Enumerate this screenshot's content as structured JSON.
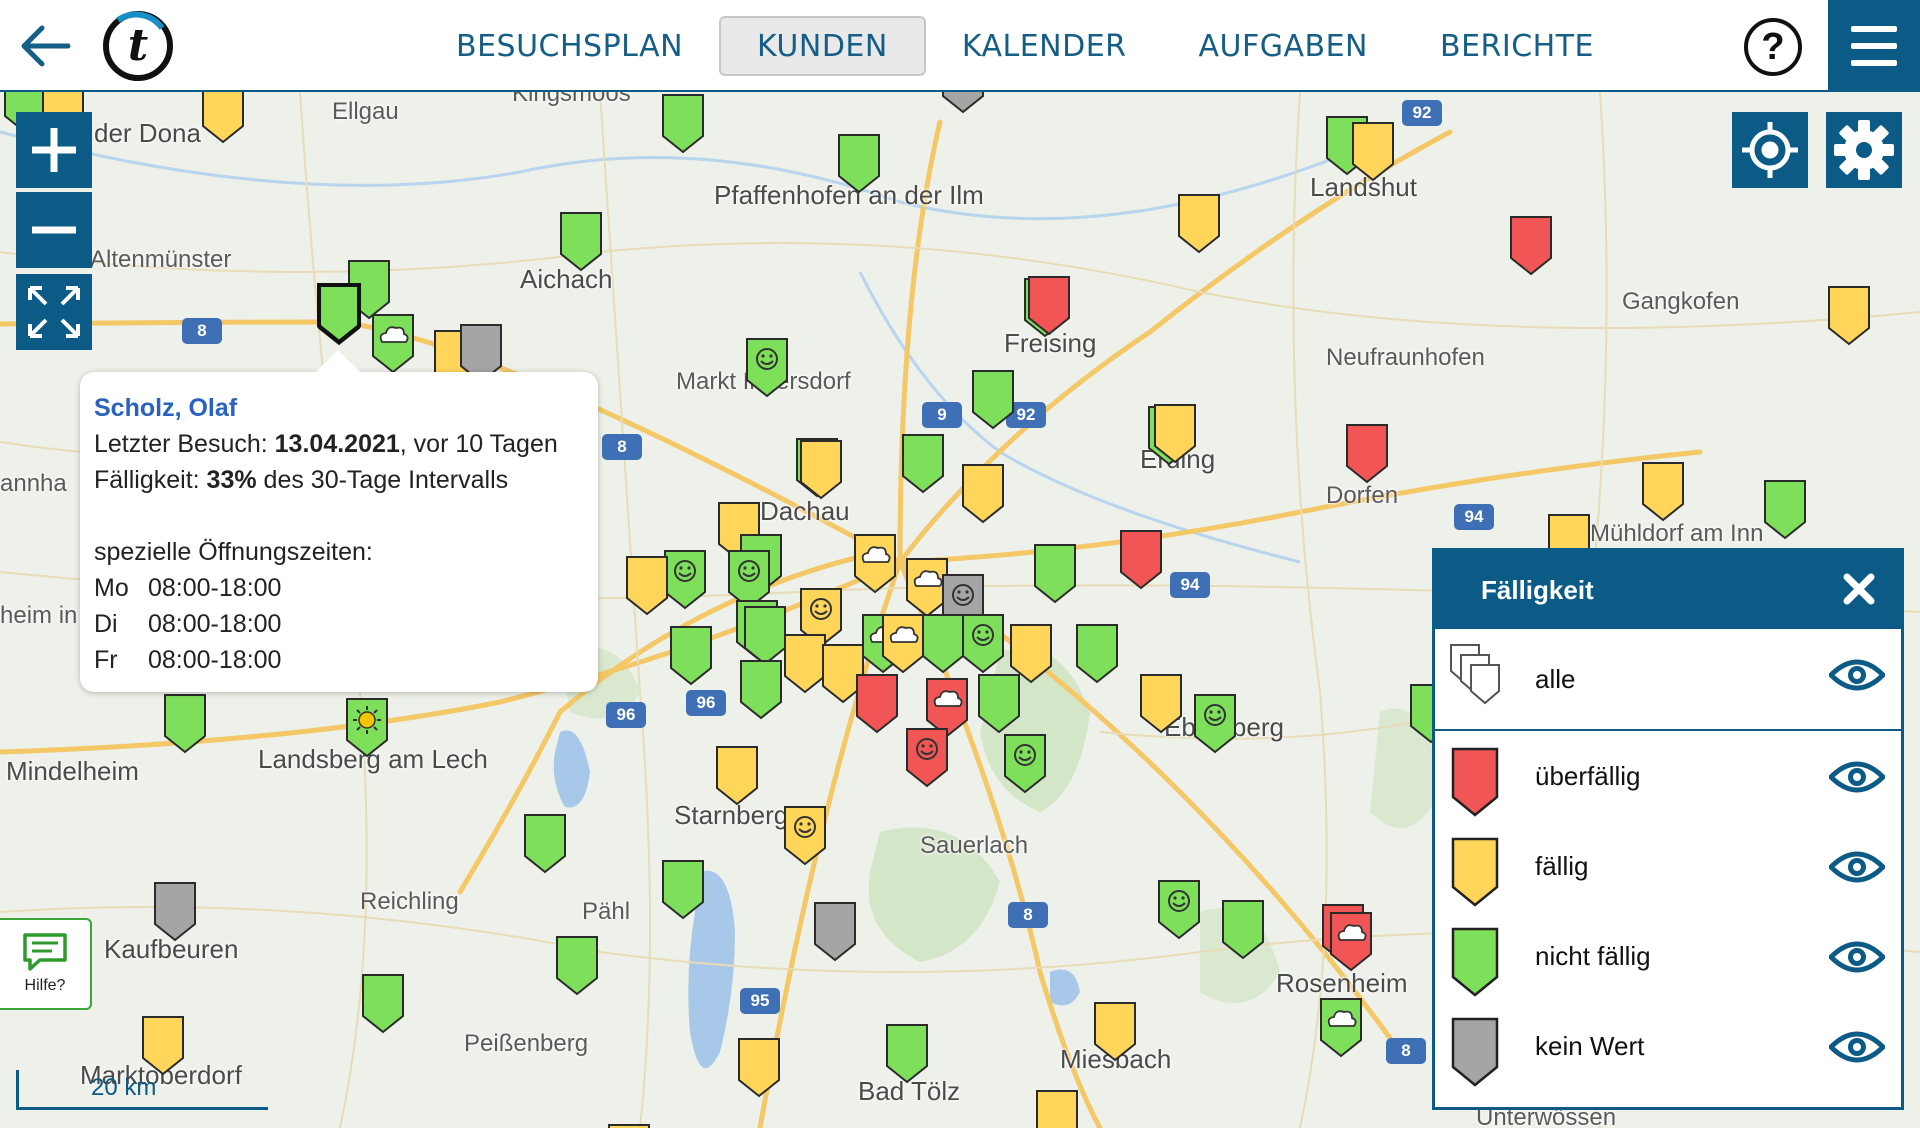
{
  "header": {
    "back_icon": "arrow-left-icon",
    "logo_letter": "t",
    "tabs": [
      {
        "label": "BESUCHSPLAN",
        "active": false
      },
      {
        "label": "KUNDEN",
        "active": true
      },
      {
        "label": "KALENDER",
        "active": false
      },
      {
        "label": "AUFGABEN",
        "active": false
      },
      {
        "label": "BERICHTE",
        "active": false
      }
    ],
    "help_label": "?",
    "menu_icon": "hamburger-menu-icon"
  },
  "map": {
    "places": [
      {
        "text": "Kingsmoos"
      },
      {
        "text": "Ellgau"
      },
      {
        "text": "der Dona"
      },
      {
        "text": "Pfaffenhofen an der Ilm"
      },
      {
        "text": "Landshut"
      },
      {
        "text": "Altenmünster"
      },
      {
        "text": "Aichach"
      },
      {
        "text": "Gangkofen"
      },
      {
        "text": "Freising"
      },
      {
        "text": "Neufraunhofen"
      },
      {
        "text": "Markt Indersdorf"
      },
      {
        "text": "Erding"
      },
      {
        "text": "Dorfen"
      },
      {
        "text": "Dachau"
      },
      {
        "text": "Mühldorf am Inn"
      },
      {
        "text": "Ebersberg"
      },
      {
        "text": "Landsberg am Lech"
      },
      {
        "text": "Mindelheim"
      },
      {
        "text": "Starnberg"
      },
      {
        "text": "Sauerlach"
      },
      {
        "text": "Reichling"
      },
      {
        "text": "Pähl"
      },
      {
        "text": "Kaufbeuren"
      },
      {
        "text": "Rosenheim"
      },
      {
        "text": "Peißenberg"
      },
      {
        "text": "Miesbach"
      },
      {
        "text": "Marktoberdorf"
      },
      {
        "text": "Bad Tölz"
      },
      {
        "text": "Unterwössen"
      },
      {
        "text": "annha"
      },
      {
        "text": "heim in"
      }
    ],
    "road_shields": [
      "92",
      "8",
      "9",
      "92",
      "8",
      "94",
      "94",
      "96",
      "96",
      "8",
      "95",
      "8"
    ],
    "scale_label": "20 km",
    "help_button_label": "Hilfe?"
  },
  "popup": {
    "name": "Scholz, Olaf",
    "last_visit_prefix": "Letzter Besuch: ",
    "last_visit_date": "13.04.2021",
    "last_visit_suffix": ", vor 10 Tagen",
    "due_prefix": "Fälligkeit: ",
    "due_percent": "33%",
    "due_suffix": " des 30-Tage Intervalls",
    "hours_title": "spezielle Öffnungszeiten:",
    "hours": [
      {
        "day": "Mo",
        "time": "08:00-18:00"
      },
      {
        "day": "Di",
        "time": "08:00-18:00"
      },
      {
        "day": "Fr",
        "time": "08:00-18:00"
      }
    ]
  },
  "legend": {
    "title": "Fälligkeit",
    "items": [
      {
        "label": "alle",
        "color": "#ffffff"
      },
      {
        "label": "überfällig",
        "color": "#f15555"
      },
      {
        "label": "fällig",
        "color": "#ffd65a"
      },
      {
        "label": "nicht fällig",
        "color": "#7ee05a"
      },
      {
        "label": "kein Wert",
        "color": "#a5a5a5"
      }
    ]
  },
  "colors": {
    "brand": "#0c5a86",
    "overdue": "#f15555",
    "due": "#ffd65a",
    "not_due": "#7ee05a",
    "no_value": "#a5a5a5"
  }
}
